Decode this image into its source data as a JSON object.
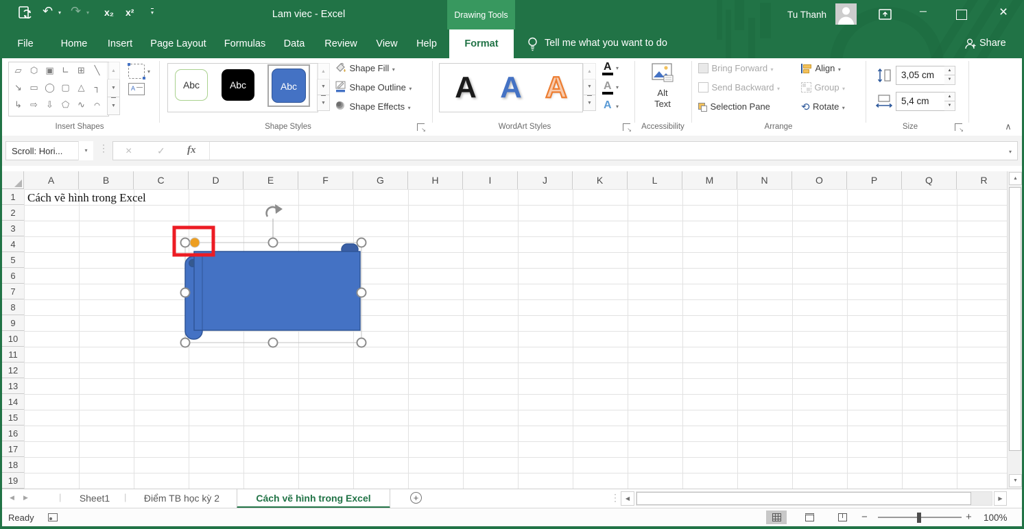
{
  "titlebar": {
    "title": "Lam viec - Excel",
    "contextual_tab": "Drawing Tools",
    "user_name": "Tu Thanh",
    "qat": {
      "subscript": "x₂",
      "superscript": "x²"
    }
  },
  "menubar": {
    "tabs": [
      "File",
      "Home",
      "Insert",
      "Page Layout",
      "Formulas",
      "Data",
      "Review",
      "View",
      "Help",
      "Format"
    ],
    "active_tab": "Format",
    "tell_me": "Tell me what you want to do",
    "share": "Share"
  },
  "ribbon": {
    "groups": {
      "insert_shapes": {
        "label": "Insert Shapes"
      },
      "shape_styles": {
        "label": "Shape Styles",
        "preview_text": "Abc",
        "fill": "Shape Fill",
        "outline": "Shape Outline",
        "effects": "Shape Effects"
      },
      "wordart": {
        "label": "WordArt Styles",
        "letter": "A"
      },
      "accessibility": {
        "label": "Accessibility",
        "alt_line1": "Alt",
        "alt_line2": "Text"
      },
      "arrange": {
        "label": "Arrange",
        "bring_forward": "Bring Forward",
        "send_backward": "Send Backward",
        "selection_pane": "Selection Pane",
        "align": "Align",
        "group": "Group",
        "rotate": "Rotate"
      },
      "size": {
        "label": "Size",
        "height_value": "3,05 cm",
        "width_value": "5,4 cm"
      }
    }
  },
  "formula_bar": {
    "name_box": "Scroll: Hori...",
    "fx_label": "fx",
    "formula_value": ""
  },
  "grid": {
    "columns": [
      "A",
      "B",
      "C",
      "D",
      "E",
      "F",
      "G",
      "H",
      "I",
      "J",
      "K",
      "L",
      "M",
      "N",
      "O",
      "P",
      "Q",
      "R"
    ],
    "rows": [
      "1",
      "2",
      "3",
      "4",
      "5",
      "6",
      "7",
      "8",
      "9",
      "10",
      "11",
      "12",
      "13",
      "14",
      "15",
      "16",
      "17",
      "18",
      "19"
    ],
    "cell_a1": "Cách vẽ hình trong Excel"
  },
  "sheet_tabs": {
    "tabs": [
      {
        "name": "Sheet1",
        "active": false
      },
      {
        "name": "Điểm TB học kỳ 2",
        "active": false
      },
      {
        "name": "Cách vẽ hình trong Excel",
        "active": true
      }
    ]
  },
  "status_bar": {
    "mode": "Ready",
    "zoom_level": "100%"
  },
  "colors": {
    "excel_green": "#217346",
    "contextual_tab_green": "#38985f",
    "shape_fill": "#4472C4",
    "shape_border": "#2F5597",
    "adjust_handle_orange": "#ED9E21",
    "highlight_red": "#EC1C24",
    "wordart_orange": "#ED7D31",
    "style_green_border": "#A9D18E"
  },
  "icons": {
    "undo": "↶",
    "redo": "↷",
    "dropdown": "▾",
    "up": "▲",
    "down": "▼",
    "left": "◀",
    "right": "▶",
    "cancel": "×",
    "enter": "✓",
    "ellipsis_v": "⋮",
    "minimize": "─",
    "close": "×",
    "collapse_ribbon": "∧",
    "minus": "−",
    "plus": "+",
    "launcher_arrow": "↘",
    "gallery": [
      "▱",
      "⬡",
      "▣",
      "∟",
      "⊞",
      "╲",
      "↘",
      "▭",
      "◯",
      "▢",
      "△",
      "┐",
      "↳",
      "⇨",
      "⇩",
      "⬠",
      "∿",
      "⌒"
    ]
  }
}
